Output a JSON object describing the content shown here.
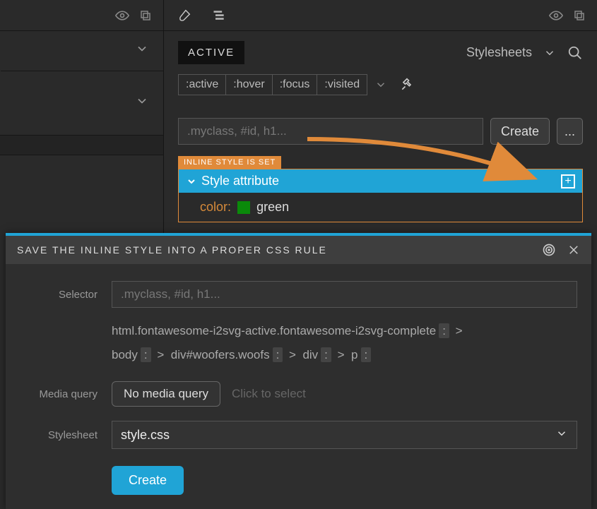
{
  "right_panel": {
    "stylesheets_label": "Stylesheets",
    "active_tab": "ACTIVE",
    "pseudo": [
      ":active",
      ":hover",
      ":focus",
      ":visited"
    ],
    "selector_placeholder": ".myclass, #id, h1...",
    "create_btn": "Create",
    "more_btn": "...",
    "inline_badge": "INLINE STYLE IS SET",
    "style_attr_header": "Style attribute",
    "css_prop": "color",
    "css_val": "green"
  },
  "dialog": {
    "title": "SAVE THE INLINE STYLE INTO A PROPER CSS RULE",
    "selector_label": "Selector",
    "selector_placeholder": ".myclass, #id, h1...",
    "path": {
      "seg1": "html.fontawesome-i2svg-active.fontawesome-i2svg-complete",
      "seg2": "body",
      "seg3": "div#woofers.woofs",
      "seg4": "div",
      "seg5": "p",
      "gt": ">"
    },
    "media_label": "Media query",
    "media_btn": "No media query",
    "media_hint": "Click to select",
    "stylesheet_label": "Stylesheet",
    "stylesheet_value": "style.css",
    "create_btn": "Create"
  }
}
